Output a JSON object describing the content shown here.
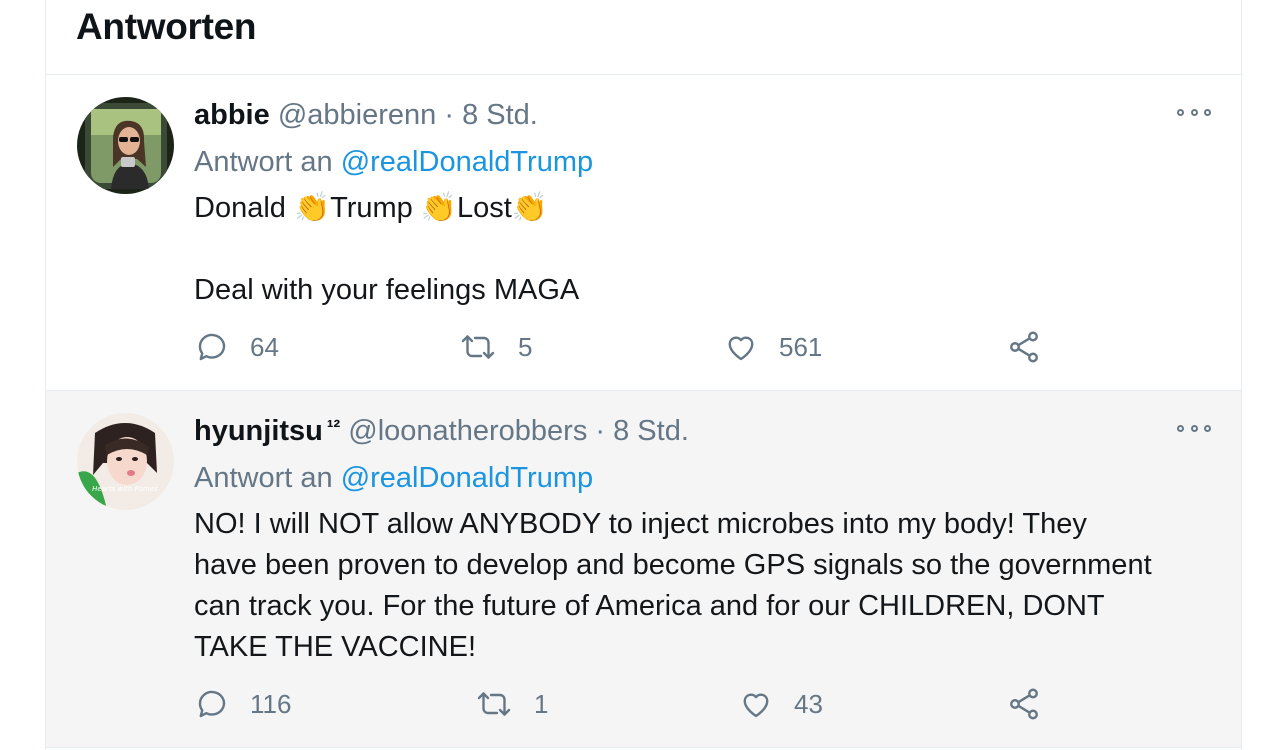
{
  "header": {
    "title": "Antworten"
  },
  "tweets": [
    {
      "display_name": "abbie",
      "badge": "",
      "handle": "@abbierenn",
      "separator": "·",
      "time": "8 Std.",
      "reply_prefix": "Antwort an",
      "reply_to": "@realDonaldTrump",
      "text_line1": "Donald 👏Trump 👏Lost👏",
      "text_line2": "Deal with your feelings MAGA",
      "replies": "64",
      "retweets": "5",
      "likes": "561"
    },
    {
      "display_name": "hyunjitsu",
      "badge": "¹²",
      "handle": "@loonatherobbers",
      "separator": "·",
      "time": "8 Std.",
      "reply_prefix": "Antwort an",
      "reply_to": "@realDonaldTrump",
      "text": "NO! I will NOT allow ANYBODY to inject microbes into my body! They have been proven to develop and become GPS signals so the government can track you. For the future of America and for our CHILDREN, DONT TAKE THE VACCINE!",
      "avatar_caption": "Hearts with Pomes",
      "replies": "116",
      "retweets": "1",
      "likes": "43"
    }
  ],
  "colors": {
    "text": "#0f1419",
    "secondary": "#657786",
    "link": "#1b95e0",
    "border": "#e6ecf0",
    "highlight_bg": "#f5f5f5"
  },
  "icons": [
    "reply-icon",
    "retweet-icon",
    "like-icon",
    "share-icon",
    "more-icon"
  ]
}
